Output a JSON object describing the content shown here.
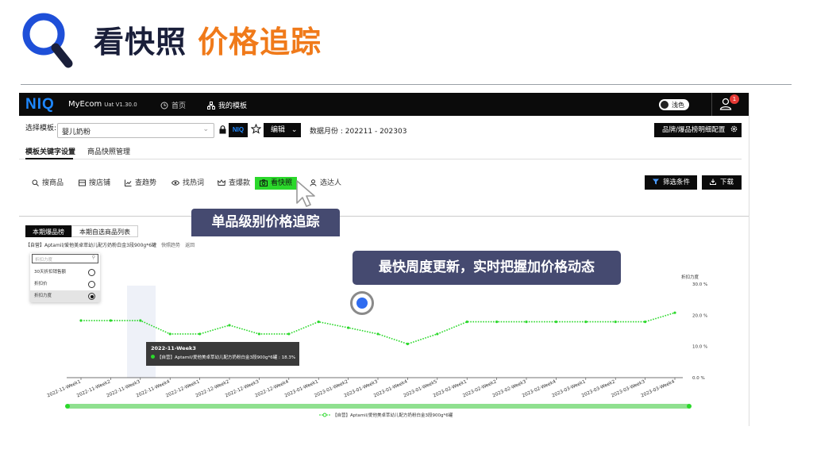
{
  "slide": {
    "title_main": "看快照",
    "title_accent": "价格追踪",
    "colors": {
      "title": "#1a1f3a",
      "accent": "#f07a1a",
      "logo": "#1e4fd8"
    }
  },
  "app": {
    "brand": "NIQ",
    "name": "MyEcom",
    "version": "Uat V1.30.0",
    "nav": [
      {
        "label": "首页",
        "icon": "clock-icon"
      },
      {
        "label": "我的模板",
        "icon": "sitemap-icon"
      }
    ],
    "theme_toggle": "浅色",
    "notification_count": "1",
    "brand_color": "#1e88ff"
  },
  "template_bar": {
    "label": "选择模板:",
    "value": "婴儿奶粉",
    "chip": "NIQ",
    "edit_label": "编辑",
    "data_month": "数据月份 : 202211 - 202303",
    "config_button": "品牌/爆品榜明细配置"
  },
  "tabs": [
    "模板关键字设置",
    "商品快照管理"
  ],
  "tools": [
    {
      "label": "搜商品",
      "icon": "search-icon"
    },
    {
      "label": "搜店铺",
      "icon": "store-icon"
    },
    {
      "label": "查趋势",
      "icon": "trend-icon"
    },
    {
      "label": "找热词",
      "icon": "eye-icon"
    },
    {
      "label": "查爆款",
      "icon": "crown-icon"
    },
    {
      "label": "看快照",
      "icon": "camera-icon"
    },
    {
      "label": "选达人",
      "icon": "person-icon"
    }
  ],
  "actions": {
    "filter": "筛选条件",
    "download": "下载"
  },
  "subtabs": [
    "本期爆品榜",
    "本期自选商品列表"
  ],
  "product_line": {
    "name": "【自营】Aptamil/爱他美卓萃幼儿配方奶粉白金3段900g*6罐",
    "link1": "快照趋势",
    "link2": "返回"
  },
  "metric_dropdown": {
    "placeholder": "折扣力度",
    "options": [
      {
        "label": "30天折扣销售额",
        "selected": false
      },
      {
        "label": "折扣价",
        "selected": false
      },
      {
        "label": "折扣力度",
        "selected": true
      }
    ]
  },
  "tooltip": {
    "title": "2022-11-Week3",
    "row": "【自营】Aptamil/爱他美卓萃幼儿配方奶粉白金3段900g*6罐 : 18.3%"
  },
  "callouts": {
    "left": "单品级别价格追踪",
    "right": "最快周度更新，实时把握加价格动态"
  },
  "chart_data": {
    "type": "line",
    "ylabel": "折扣力度",
    "y_ticks": [
      "30.0 %",
      "20.0 %",
      "10.0 %",
      "0.0 %"
    ],
    "ylim": [
      0,
      30
    ],
    "grid": false,
    "legend_position": "bottom",
    "line_color": "#2bd82b",
    "categories": [
      "2022-11-Week1",
      "2022-11-Week2",
      "2022-11-Week3",
      "2022-11-Week4",
      "2022-12-Week1",
      "2022-12-Week2",
      "2022-12-Week3",
      "2022-12-Week4",
      "2023-01-Week1",
      "2023-01-Week2",
      "2023-01-Week3",
      "2023-01-Week4",
      "2023-01-Week5",
      "2023-02-Week1",
      "2023-02-Week2",
      "2023-02-Week3",
      "2023-02-Week4",
      "2023-03-Week1",
      "2023-03-Week2",
      "2023-03-Week3",
      "2023-03-Week4"
    ],
    "series": [
      {
        "name": "【自营】Aptamil/爱他美卓萃幼儿配方奶粉白金3段900g*6罐",
        "values": [
          18.3,
          18.3,
          18.3,
          14.0,
          14.0,
          16.8,
          14.0,
          14.0,
          17.9,
          16.0,
          14.0,
          10.8,
          14.0,
          17.9,
          17.9,
          17.9,
          17.9,
          17.9,
          17.9,
          17.9,
          20.8
        ]
      }
    ]
  }
}
